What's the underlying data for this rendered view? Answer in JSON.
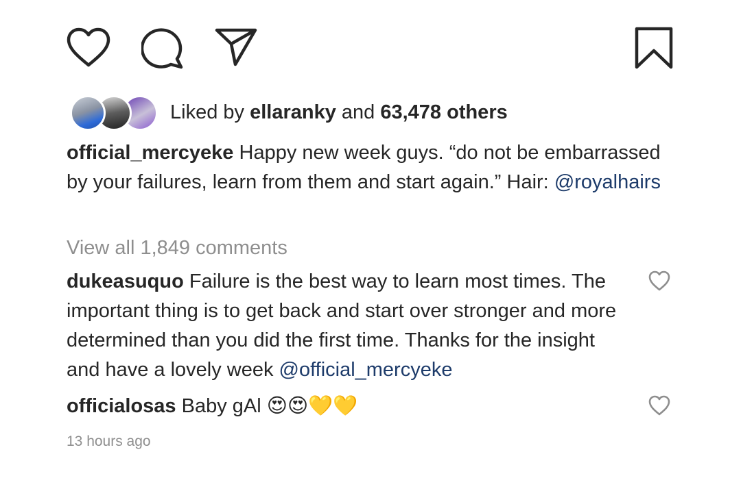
{
  "actions": {
    "like_icon": "heart-outline-icon",
    "comment_icon": "comment-bubble-icon",
    "share_icon": "paper-plane-icon",
    "save_icon": "bookmark-icon"
  },
  "likes": {
    "prefix": "Liked by ",
    "first_user": "ellaranky",
    "conjunction": " and ",
    "others": "63,478 others"
  },
  "caption": {
    "username": "official_mercyeke",
    "text": " Happy new week guys. “do not be embarrassed by your failures, learn from them and start again.” Hair: ",
    "mention": "@royalhairs"
  },
  "view_all_comments": "View all 1,849 comments",
  "comments": [
    {
      "username": "dukeasuquo",
      "text": " Failure is the best way to learn most times. The important thing is to get back and start over stronger and more determined than you did the first time. Thanks for the insight and have a lovely week ",
      "mention": "@official_mercyeke"
    },
    {
      "username": "officialosas",
      "text": " Baby gAl ",
      "emojis": "😍😍💛💛"
    }
  ],
  "timestamp": "13 hours ago",
  "colors": {
    "text": "#262626",
    "secondary": "#8e8e8e",
    "mention": "#1d3b6a"
  }
}
